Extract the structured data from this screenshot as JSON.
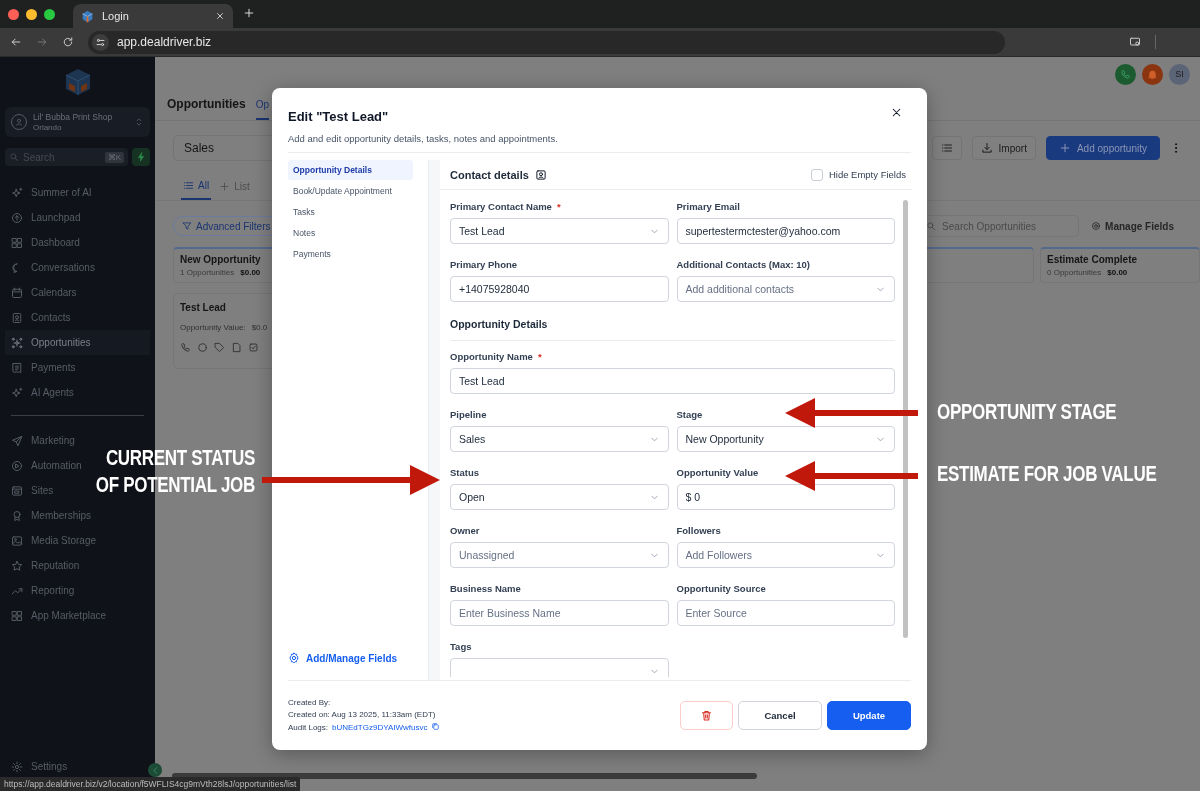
{
  "browser": {
    "tab_title": "Login",
    "url": "app.dealdriver.biz",
    "status_url": "https://app.dealdriver.biz/v2/location/f5WFLIS4cg9mVth28lsJ/opportunities/list"
  },
  "sidebar": {
    "account": {
      "name": "Lil' Bubba Print Shop",
      "location": "Orlando"
    },
    "search": {
      "placeholder": "Search",
      "shortcut": "⌘K"
    },
    "nav_groups": [
      [
        {
          "label": "Summer of AI",
          "selected": false
        },
        {
          "label": "Launchpad",
          "selected": false
        },
        {
          "label": "Dashboard",
          "selected": false
        },
        {
          "label": "Conversations",
          "selected": false
        },
        {
          "label": "Calendars",
          "selected": false
        },
        {
          "label": "Contacts",
          "selected": false
        },
        {
          "label": "Opportunities",
          "selected": true
        },
        {
          "label": "Payments",
          "selected": false
        },
        {
          "label": "AI Agents",
          "selected": false
        }
      ],
      [
        {
          "label": "Marketing",
          "selected": false
        },
        {
          "label": "Automation",
          "selected": false
        },
        {
          "label": "Sites",
          "selected": false
        },
        {
          "label": "Memberships",
          "selected": false
        },
        {
          "label": "Media Storage",
          "selected": false
        },
        {
          "label": "Reputation",
          "selected": false
        },
        {
          "label": "Reporting",
          "selected": false
        },
        {
          "label": "App Marketplace",
          "selected": false
        }
      ]
    ],
    "settings": "Settings"
  },
  "page": {
    "title": "Opportunities",
    "tab": "Op",
    "avatar": "SI",
    "pipeline": "Sales",
    "import_button": "Import",
    "add_button": "Add opportunity",
    "view_tabs": [
      {
        "label": "All",
        "selected": true
      },
      {
        "label": "List",
        "selected": false
      }
    ],
    "filters_button": "Advanced Filters",
    "search_placeholder": "Search Opportunities",
    "manage_fields": "Manage Fields",
    "columns": [
      {
        "name": "New Opportunity",
        "count": "1 Opportunities",
        "total": "$0.00",
        "cards": [
          {
            "name": "Test Lead",
            "value_label": "Opportunity Value:",
            "value": "$0.0"
          }
        ]
      },
      {
        "name": "Estimate Complete",
        "count": "0 Opportunities",
        "total": "$0.00"
      }
    ]
  },
  "modal": {
    "title": "Edit \"Test Lead\"",
    "subtitle": "Add and edit opportunity details, tasks, notes and appointments.",
    "nav": [
      {
        "label": "Opportunity Details",
        "selected": true
      },
      {
        "label": "Book/Update Appointment",
        "selected": false
      },
      {
        "label": "Tasks",
        "selected": false
      },
      {
        "label": "Notes",
        "selected": false
      },
      {
        "label": "Payments",
        "selected": false
      }
    ],
    "manage_fields": "Add/Manage Fields",
    "required_mark": "*",
    "contact_heading": "Contact details",
    "hide_empty": {
      "label": "Hide Empty Fields",
      "checked": false
    },
    "contact_fields": [
      {
        "label": "Primary Contact Name",
        "required": true,
        "kind": "select",
        "value": "Test Lead"
      },
      {
        "label": "Primary Email",
        "required": false,
        "kind": "input",
        "value": "supertestermctester@yahoo.com"
      },
      {
        "label": "Primary Phone",
        "required": false,
        "kind": "input",
        "value": "+14075928040"
      },
      {
        "label": "Additional Contacts (Max: 10)",
        "required": false,
        "kind": "select",
        "placeholder": "Add additional contacts"
      }
    ],
    "details_heading": "Opportunity Details",
    "name_field": {
      "label": "Opportunity Name",
      "required": true,
      "kind": "input",
      "value": "Test Lead"
    },
    "detail_fields": [
      {
        "label": "Pipeline",
        "required": false,
        "kind": "select",
        "value": "Sales"
      },
      {
        "label": "Stage",
        "required": false,
        "kind": "select",
        "value": "New Opportunity"
      },
      {
        "label": "Status",
        "required": false,
        "kind": "select",
        "value": "Open"
      },
      {
        "label": "Opportunity Value",
        "required": false,
        "kind": "input",
        "value": "$ 0"
      },
      {
        "label": "Owner",
        "required": false,
        "kind": "select",
        "placeholder": "Unassigned"
      },
      {
        "label": "Followers",
        "required": false,
        "kind": "select",
        "placeholder": "Add Followers"
      },
      {
        "label": "Business Name",
        "required": false,
        "kind": "input",
        "placeholder": "Enter Business Name"
      },
      {
        "label": "Opportunity Source",
        "required": false,
        "kind": "input",
        "placeholder": "Enter Source"
      },
      {
        "label": "Tags",
        "required": false,
        "kind": "select"
      }
    ],
    "created_by": "Created By:",
    "created_on": "Created on: Aug 13 2025, 11:33am (EDT)",
    "audit_label": "Audit Logs:",
    "audit_id": "bUNEdTGz9DYAIWwfusvc",
    "cancel": "Cancel",
    "update": "Update"
  },
  "annotations": [
    {
      "text": "CURRENT STATUS\nOF POTENTIAL JOB"
    },
    {
      "text": "OPPORTUNITY STAGE"
    },
    {
      "text": "ESTIMATE FOR JOB VALUE"
    }
  ]
}
